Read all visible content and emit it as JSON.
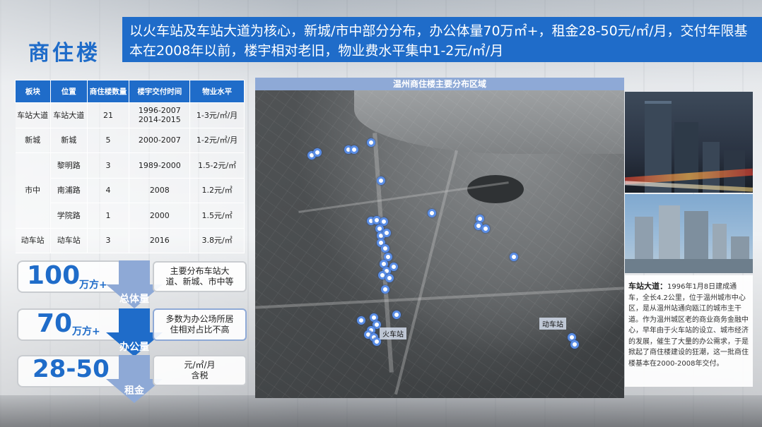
{
  "page_title": "商住楼",
  "headline": "以火车站及车站大道为核心，新城/市中部分分布，办公体量70万㎡+，租金28-50元/㎡/月，交付年限基本在2008年以前，楼宇相对老旧，物业费水平集中1-2元/㎡/月",
  "table": {
    "headers": [
      "板块",
      "位置",
      "商住楼数量",
      "楼宇交付时间",
      "物业水平"
    ],
    "rows": [
      {
        "block": "车站大道",
        "location": "车站大道",
        "count": "21",
        "delivery": "1996-2007\n2014-2015",
        "fee": "1-3元/㎡/月"
      },
      {
        "block": "新城",
        "location": "新城",
        "count": "5",
        "delivery": "2000-2007",
        "fee": "1-2元/㎡/月"
      },
      {
        "block": "",
        "location": "黎明路",
        "count": "3",
        "delivery": "1989-2000",
        "fee": "1.5-2元/㎡"
      },
      {
        "block": "市中",
        "location": "南浦路",
        "count": "4",
        "delivery": "2008",
        "fee": "1.2元/㎡"
      },
      {
        "block": "",
        "location": "学院路",
        "count": "1",
        "delivery": "2000",
        "fee": "1.5元/㎡"
      },
      {
        "block": "动车站",
        "location": "动车站",
        "count": "3",
        "delivery": "2016",
        "fee": "3.8元/㎡"
      }
    ]
  },
  "stats": [
    {
      "value": "100",
      "unit": "万方+",
      "label": "总体量",
      "note": "主要分布车站大道、新城、市中等"
    },
    {
      "value": "70",
      "unit": "万方+",
      "label": "办公量",
      "note": "多数为办公场所居住相对占比不高"
    },
    {
      "value": "28-50",
      "unit": "",
      "label": "租金",
      "note": "元/㎡/月\n含税"
    }
  ],
  "map": {
    "title": "温州商住楼主要分布区域",
    "labels": {
      "station": "火车站",
      "high_speed": "动车站"
    },
    "pin_count": 36
  },
  "description": {
    "heading": "车站大道：",
    "body": "1996年1月8日建成通车，全长4.2公里，位于温州城市中心区，是从温州站通向瓯江的城市主干道。作为温州城区老的商业商务金融中心，早年由于火车站的设立、城市经济的发展，催生了大量的办公需求，于是掀起了商住楼建设的狂潮，这一批商住楼基本在2000-2008年交付。"
  },
  "colors": {
    "accent": "#1f6cc9",
    "map_header": "#8ea9d6",
    "pin": "#5b8ee6"
  }
}
